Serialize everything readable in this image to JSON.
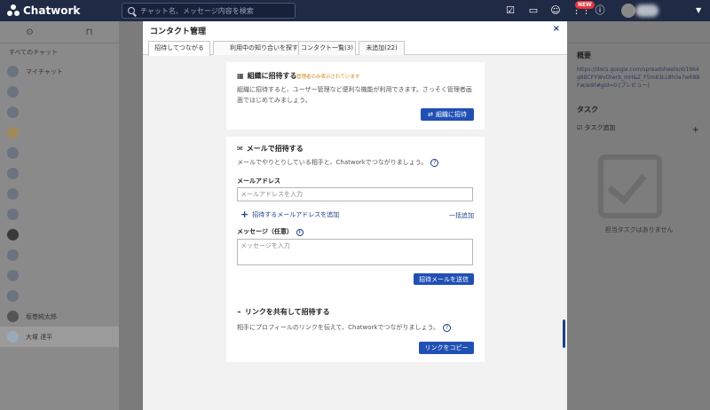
{
  "header": {
    "brand": "Chatwork",
    "search_placeholder": "チャット名、メッセージ内容を検索",
    "new_badge": "NEW",
    "icons": [
      "task-icon",
      "folder-icon",
      "contact-icon",
      "apps-icon",
      "info-icon"
    ]
  },
  "sidebar": {
    "all_chats": "すべてのチャット",
    "items": [
      {
        "label": "マイチャット"
      },
      {
        "label": ""
      },
      {
        "label": ""
      },
      {
        "label": ""
      },
      {
        "label": ""
      },
      {
        "label": ""
      },
      {
        "label": ""
      },
      {
        "label": ""
      },
      {
        "label": ""
      },
      {
        "label": ""
      },
      {
        "label": ""
      },
      {
        "label": ""
      },
      {
        "label": "坂巻純太郎"
      },
      {
        "label": "大塚 達平"
      }
    ]
  },
  "right_panel": {
    "overview_title": "概要",
    "url_text": "https://docs.google.com/spreadsheets/d/1964g8BCFYWvOlwrb_mH&Z_F5m83LL8h0a7wR8BFw/edit#gid=0",
    "preview": "プレビュー",
    "task_title": "タスク",
    "task_add": "タスク追加",
    "no_tasks": "担当タスクはありません"
  },
  "dialog": {
    "title": "コンタクト管理",
    "close": "×",
    "tabs": [
      {
        "label": "招待してつながる"
      },
      {
        "label": "利用中の知り合いを探す"
      },
      {
        "label": "コンタクト一覧(3)"
      },
      {
        "label": "未追加(22)"
      }
    ],
    "org": {
      "title": "組織に招待する",
      "note": "管理者のみ表示されています",
      "text": "組織に招待すると、ユーザー管理など便利な機能が利用できます。さっそく管理者画面ではじめてみましょう。",
      "button": "組織に招待"
    },
    "mail": {
      "title": "メールで招待する",
      "text": "メールでやりとりしている相手と、Chatworkでつながりましょう。",
      "address_label": "メールアドレス",
      "address_placeholder": "メールアドレスを入力",
      "add_address": "招待するメールアドレスを追加",
      "bulk_add": "一括追加",
      "message_label": "メッセージ（任意）",
      "message_placeholder": "メッセージを入力",
      "send_button": "招待メールを送信"
    },
    "link": {
      "title": "リンクを共有して招待する",
      "text": "相手にプロフィールのリンクを伝えて、Chatworkでつながりましょう。",
      "copy_button": "リンクをコピー"
    }
  }
}
